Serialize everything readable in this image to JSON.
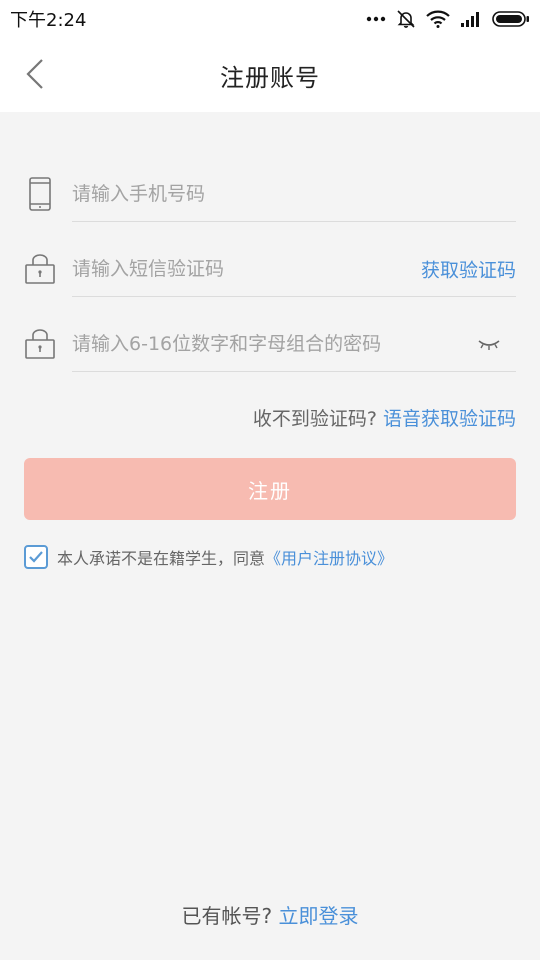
{
  "status_bar": {
    "time": "下午2:24",
    "icons": [
      "more-dots-icon",
      "bell-off-icon",
      "wifi-icon",
      "signal-icon",
      "battery-icon"
    ]
  },
  "nav": {
    "back_icon": "chevron-left-icon",
    "title": "注册账号"
  },
  "form": {
    "phone": {
      "icon": "phone-icon",
      "placeholder": "请输入手机号码",
      "value": ""
    },
    "sms_code": {
      "icon": "lock-icon",
      "placeholder": "请输入短信验证码",
      "value": "",
      "action_label": "获取验证码"
    },
    "password": {
      "icon": "lock-icon",
      "placeholder": "请输入6-16位数字和字母组合的密码",
      "value": "",
      "toggle_icon": "eye-closed-icon"
    }
  },
  "voice": {
    "prefix": "收不到验证码?",
    "link": "语音获取验证码"
  },
  "register_button": {
    "label": "注册",
    "color": "#f7bbb1"
  },
  "agreement": {
    "checked": true,
    "text": "本人承诺不是在籍学生，同意",
    "link": "《用户注册协议》"
  },
  "login": {
    "prefix": "已有帐号?",
    "link": "立即登录"
  },
  "colors": {
    "accent": "#4a90d9",
    "background": "#f4f4f4",
    "divider": "#dcdcdc"
  }
}
